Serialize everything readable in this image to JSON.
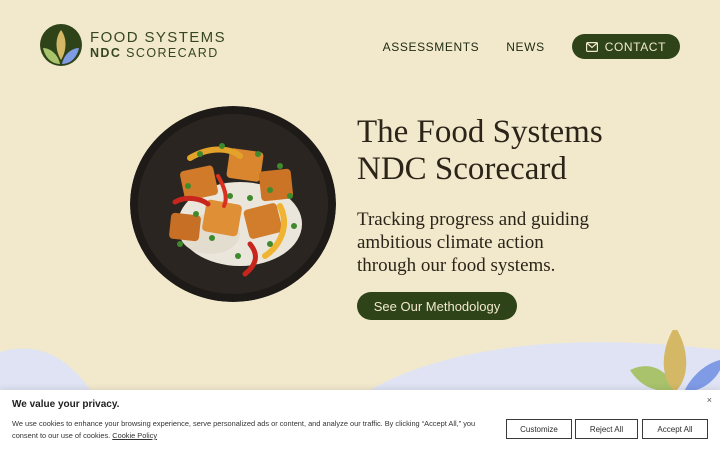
{
  "brand": {
    "line1": "FOOD SYSTEMS",
    "line2_bold": "NDC",
    "line2_rest": " SCORECARD"
  },
  "nav": {
    "items": [
      "ASSESSMENTS",
      "NEWS"
    ],
    "contact_label": "CONTACT",
    "contact_icon": "mail-icon"
  },
  "hero": {
    "title_lines": [
      "The Food Systems",
      "NDC Scorecard"
    ],
    "subtitle_lines": [
      "Tracking progress and guiding",
      "ambitious climate action",
      "through our food systems."
    ],
    "cta_label": "See Our Methodology"
  },
  "cookie_banner": {
    "title": "We value your privacy.",
    "text": "We use cookies to enhance your browsing experience, serve personalized ads or content, and analyze our traffic. By clicking “Accept All,” you consent to our use of cookies. ",
    "link": "Cookie Policy",
    "buttons": [
      "Customize",
      "Reject All",
      "Accept All"
    ],
    "close": "×"
  },
  "colors": {
    "background": "#f2e9cd",
    "accent": "#2e4318",
    "leaf_gold": "#d4b865",
    "leaf_green": "#a9c36c",
    "leaf_blue": "#7f9be6",
    "wave": "#dfe3f3"
  }
}
